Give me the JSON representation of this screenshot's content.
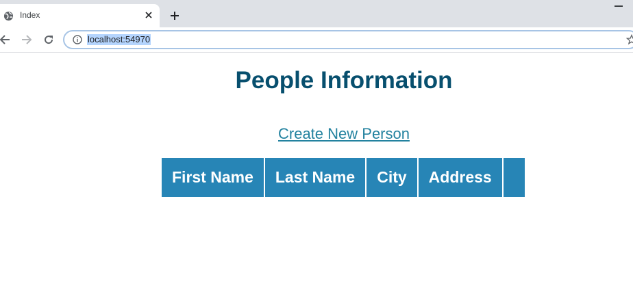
{
  "browser": {
    "tab": {
      "title": "Index",
      "favicon": "globe-icon",
      "close_icon": "close-icon"
    },
    "new_tab_icon": "plus-icon",
    "window_controls": {
      "minimize_icon": "minimize-icon"
    },
    "nav": {
      "back_icon": "back-arrow-icon",
      "forward_icon": "forward-arrow-icon",
      "reload_icon": "reload-icon"
    },
    "address_bar": {
      "url": "localhost:54970",
      "info_icon": "info-icon",
      "bookmark_icon": "star-icon"
    }
  },
  "page": {
    "title": "People Information",
    "create_link": "Create New Person",
    "table": {
      "headers": [
        "First Name",
        "Last Name",
        "City",
        "Address",
        ""
      ],
      "rows": []
    }
  },
  "colors": {
    "title": "#074f6e",
    "link": "#23829f",
    "table_header_bg": "#2785b6",
    "url_highlight": "#b4d4fd"
  }
}
